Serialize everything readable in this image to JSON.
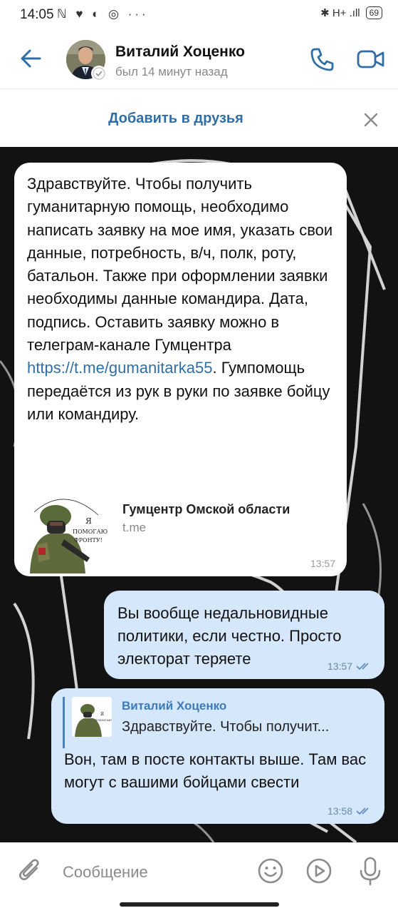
{
  "status_bar": {
    "time": "14:05",
    "left_icons": "ℕ ♥ ◐ ◎ ···",
    "right_icons": "✱ H+ .ıll",
    "battery": "69"
  },
  "header": {
    "contact_name": "Виталий Хоценко",
    "last_seen": "был 14 минут назад",
    "icons": [
      "back-arrow-icon",
      "phone-icon",
      "video-camera-icon"
    ]
  },
  "add_bar": {
    "label": "Добавить в друзья",
    "close_icon": "close-icon"
  },
  "messages": {
    "incoming": {
      "text_before_link": "Здравствуйте. Чтобы получить гуманитарную помощь, необходимо написать заявку на мое имя, указать свои данные, потребность, в/ч, полк, роту, батальон. Также при оформлении заявки необходимы данные командира. Дата, подпись. Оставить заявку можно в телеграм-канале Гумцентра ",
      "link": "https://t.me/gumanitarka55",
      "text_after_link": ". Гумпомощь передаётся из рук в руки по заявке бойцу или командиру.",
      "preview": {
        "title": "Гумцентр Омской области",
        "site": "t.me",
        "image_caption": "Гумцентр Омской области · Я помогаю фронту!"
      },
      "time": "13:57"
    },
    "outgoing_1": {
      "text": "Вы вообще недальновидные политики, если честно. Просто электорат теряете",
      "time": "13:57"
    },
    "outgoing_2": {
      "reply_name": "Виталий Хоценко",
      "reply_text": "Здравствуйте. Чтобы получит...",
      "text": "Вон, там в посте контакты выше. Там вас могут с вашими бойцами свести",
      "time": "13:58"
    }
  },
  "composer": {
    "placeholder": "Сообщение",
    "icons": [
      "paperclip-icon",
      "emoji-icon",
      "play-icon",
      "microphone-icon"
    ]
  },
  "colors": {
    "accent": "#2f6ea6",
    "outgoing_bubble": "#d5e7fb",
    "chat_background": "#121212"
  }
}
